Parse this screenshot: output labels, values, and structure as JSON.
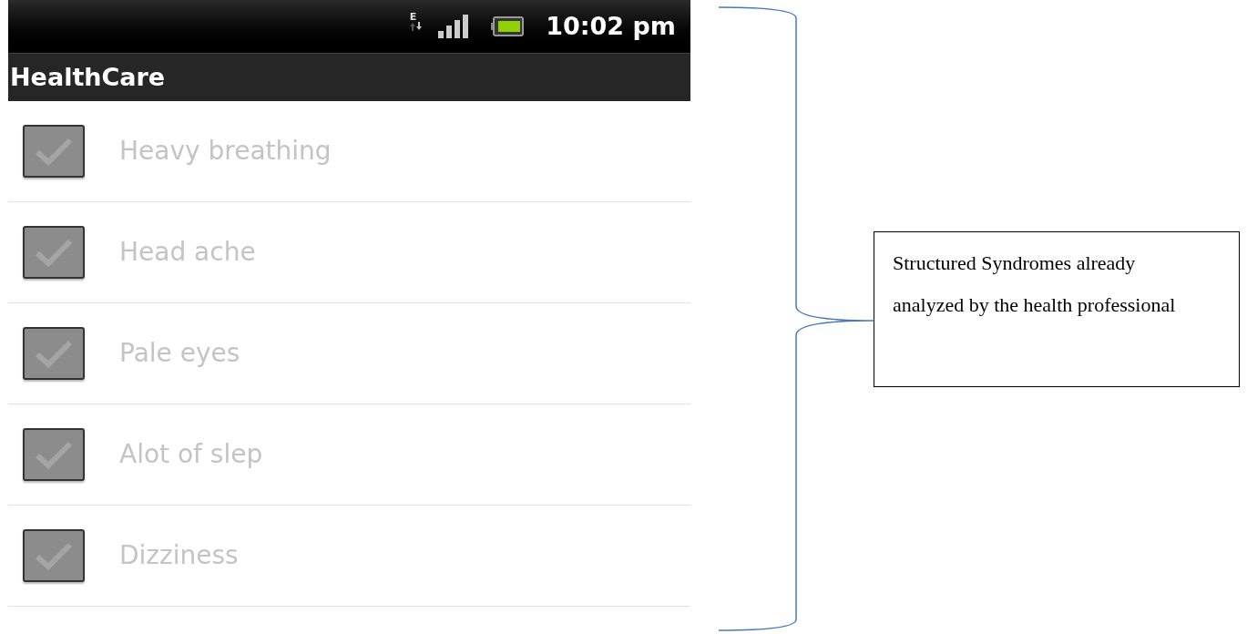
{
  "status_bar": {
    "network_type": "E",
    "time": "10:02 pm"
  },
  "app_title": "HealthCare",
  "symptoms": [
    {
      "label": "Heavy breathing",
      "checked": true,
      "disabled": true
    },
    {
      "label": "Head ache",
      "checked": true,
      "disabled": true
    },
    {
      "label": "Pale eyes",
      "checked": true,
      "disabled": true
    },
    {
      "label": "Alot of slep",
      "checked": true,
      "disabled": true
    },
    {
      "label": "Dizziness",
      "checked": true,
      "disabled": true
    }
  ],
  "annotation": {
    "text": "Structured Syndromes already analyzed by the health professional"
  }
}
